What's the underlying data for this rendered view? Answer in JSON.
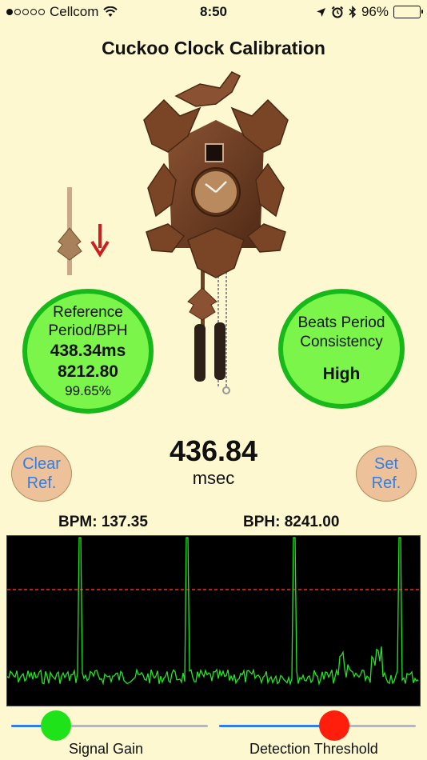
{
  "status": {
    "carrier": "Cellcom",
    "time": "8:50",
    "battery": "96%",
    "battery_level": 0.96
  },
  "title": "Cuckoo Clock Calibration",
  "reference": {
    "line1": "Reference",
    "line2": "Period/BPH",
    "period": "438.34ms",
    "bph": "8212.80",
    "percent": "99.65%"
  },
  "consistency": {
    "line1": "Beats Period",
    "line2": "Consistency",
    "value": "High"
  },
  "buttons": {
    "clear_l1": "Clear",
    "clear_l2": "Ref.",
    "set_l1": "Set",
    "set_l2": "Ref."
  },
  "measurement": {
    "value": "436.84",
    "unit": "msec"
  },
  "bpm": "BPM: 137.35",
  "bph": "BPH: 8241.00",
  "sliders": {
    "gain_label": "Signal Gain",
    "gain_value": 0.18,
    "threshold_label": "Detection Threshold",
    "threshold_value": 0.6
  },
  "colors": {
    "background": "#fdf8cf",
    "gauge_fill": "#7cf54b",
    "gauge_ring": "#17b81a",
    "button_fill": "#edc29a",
    "button_text": "#2f7ee8",
    "waveform": "#22e522",
    "threshold_line": "#ff2a1a"
  }
}
